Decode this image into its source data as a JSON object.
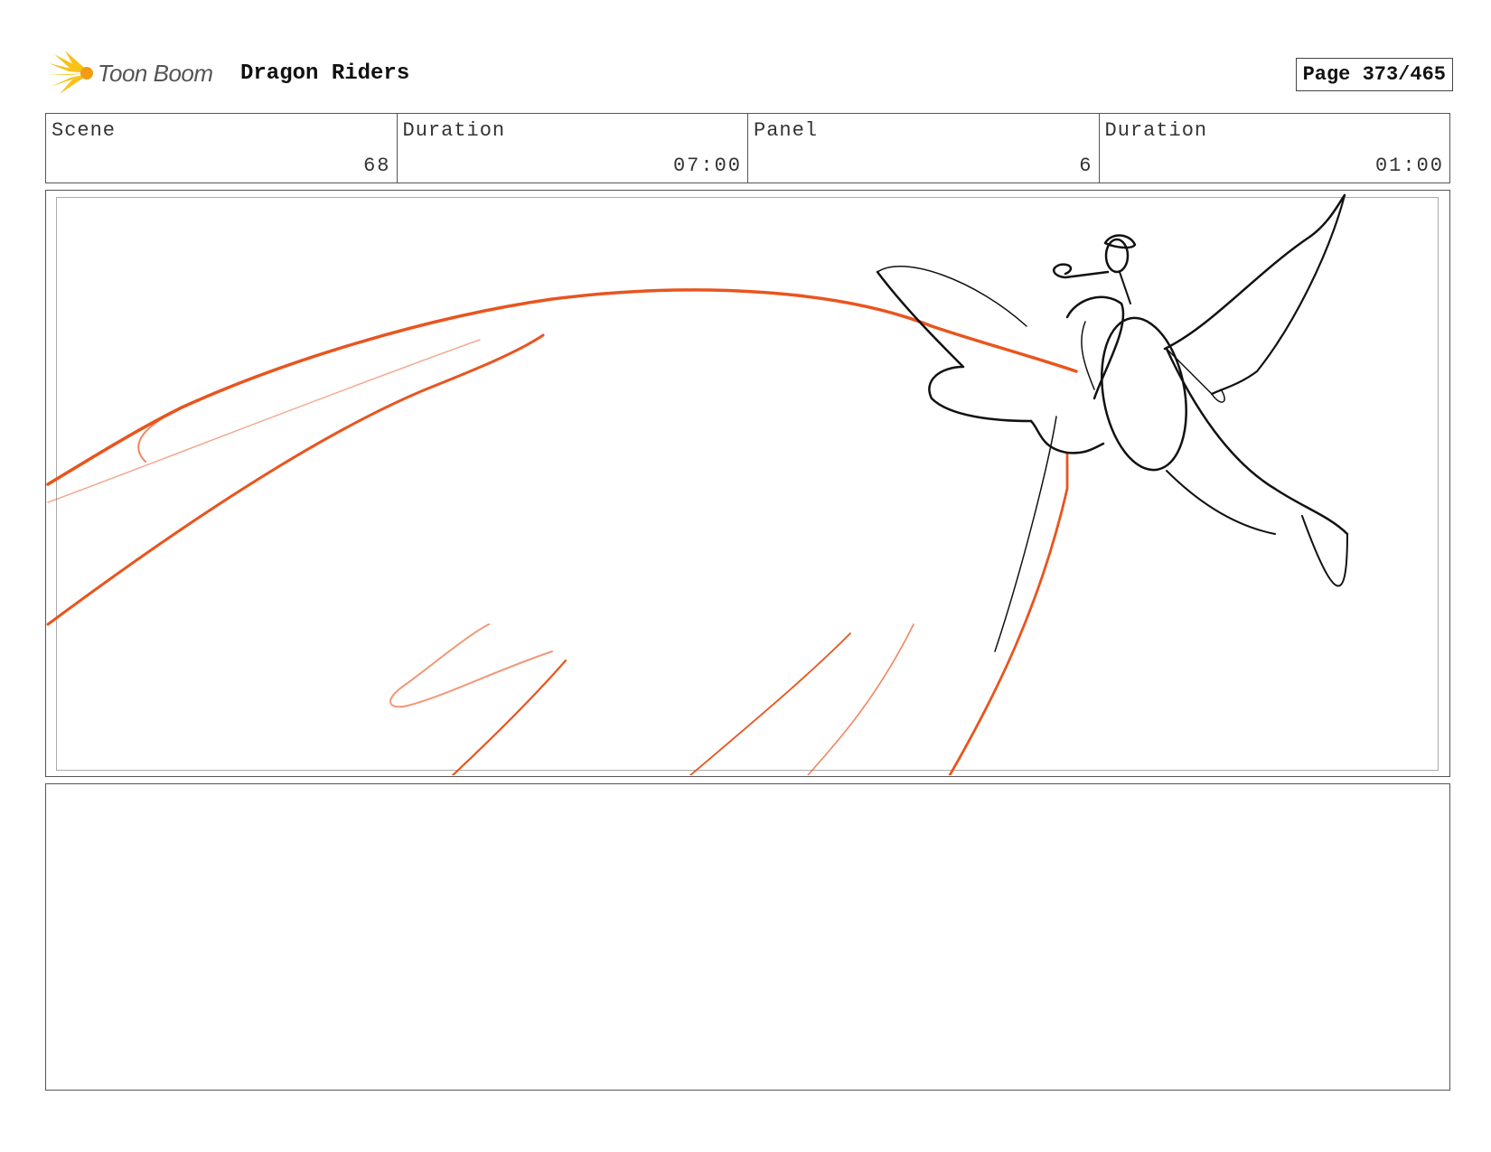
{
  "header": {
    "logo_text": "Toon Boom",
    "project_title": "Dragon Riders",
    "page_label": "Page 373/465"
  },
  "info": {
    "scene_label": "Scene",
    "scene_value": "68",
    "scene_duration_label": "Duration",
    "scene_duration_value": "07:00",
    "panel_label": "Panel",
    "panel_value": "6",
    "panel_duration_label": "Duration",
    "panel_duration_value": "01:00"
  },
  "colors": {
    "accent_orange": "#e8551e",
    "sketch_black": "#111111",
    "logo_yellow": "#f6c21a"
  },
  "icons": {
    "logo": "toon-boom-starburst-icon"
  }
}
